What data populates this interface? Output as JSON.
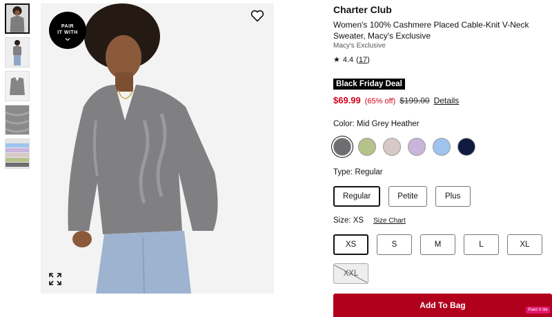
{
  "thumbnails": [
    {
      "alt": "model front"
    },
    {
      "alt": "model full"
    },
    {
      "alt": "flat lay"
    },
    {
      "alt": "knit detail"
    },
    {
      "alt": "color options"
    }
  ],
  "hero": {
    "pair_badge_line1": "PAIR",
    "pair_badge_line2": "IT WITH",
    "icons": {
      "wishlist": "heart-icon",
      "expand": "expand-icon",
      "chevron": "chevron-down-icon"
    }
  },
  "product": {
    "brand": "Charter Club",
    "title": "Women's 100% Cashmere Placed Cable-Knit V-Neck Sweater, Macy's Exclusive",
    "subbrand": "Macy's Exclusive",
    "rating": "4.4",
    "review_count": "17",
    "deal_badge": "Black Friday Deal",
    "sale_price": "$69.99",
    "discount": "(65% off)",
    "original_price": "$199.00",
    "details_link": "Details"
  },
  "color": {
    "label": "Color: Mid Grey Heather",
    "swatches": [
      {
        "name": "Mid Grey Heather",
        "hex": "#6e6e70",
        "selected": true
      },
      {
        "name": "Sage",
        "hex": "#b5c28a"
      },
      {
        "name": "Blush Grey",
        "hex": "#d7c9c6"
      },
      {
        "name": "Lavender",
        "hex": "#c9b5dc"
      },
      {
        "name": "Light Blue",
        "hex": "#9fc3ee"
      },
      {
        "name": "Navy",
        "hex": "#111a3f"
      }
    ]
  },
  "type": {
    "label": "Type: Regular",
    "options": [
      "Regular",
      "Petite",
      "Plus"
    ],
    "selected": "Regular"
  },
  "size": {
    "label": "Size: XS",
    "size_chart": "Size Chart",
    "options": [
      "XS",
      "S",
      "M",
      "L",
      "XL",
      "XXL"
    ],
    "selected": "XS",
    "unavailable": [
      "XXL"
    ]
  },
  "cta": {
    "add_to_bag": "Add To Bag"
  },
  "overlay": {
    "paint_label": "Paint X lite"
  },
  "colors": {
    "accent_red": "#b0001b",
    "price_red": "#d0021b"
  }
}
